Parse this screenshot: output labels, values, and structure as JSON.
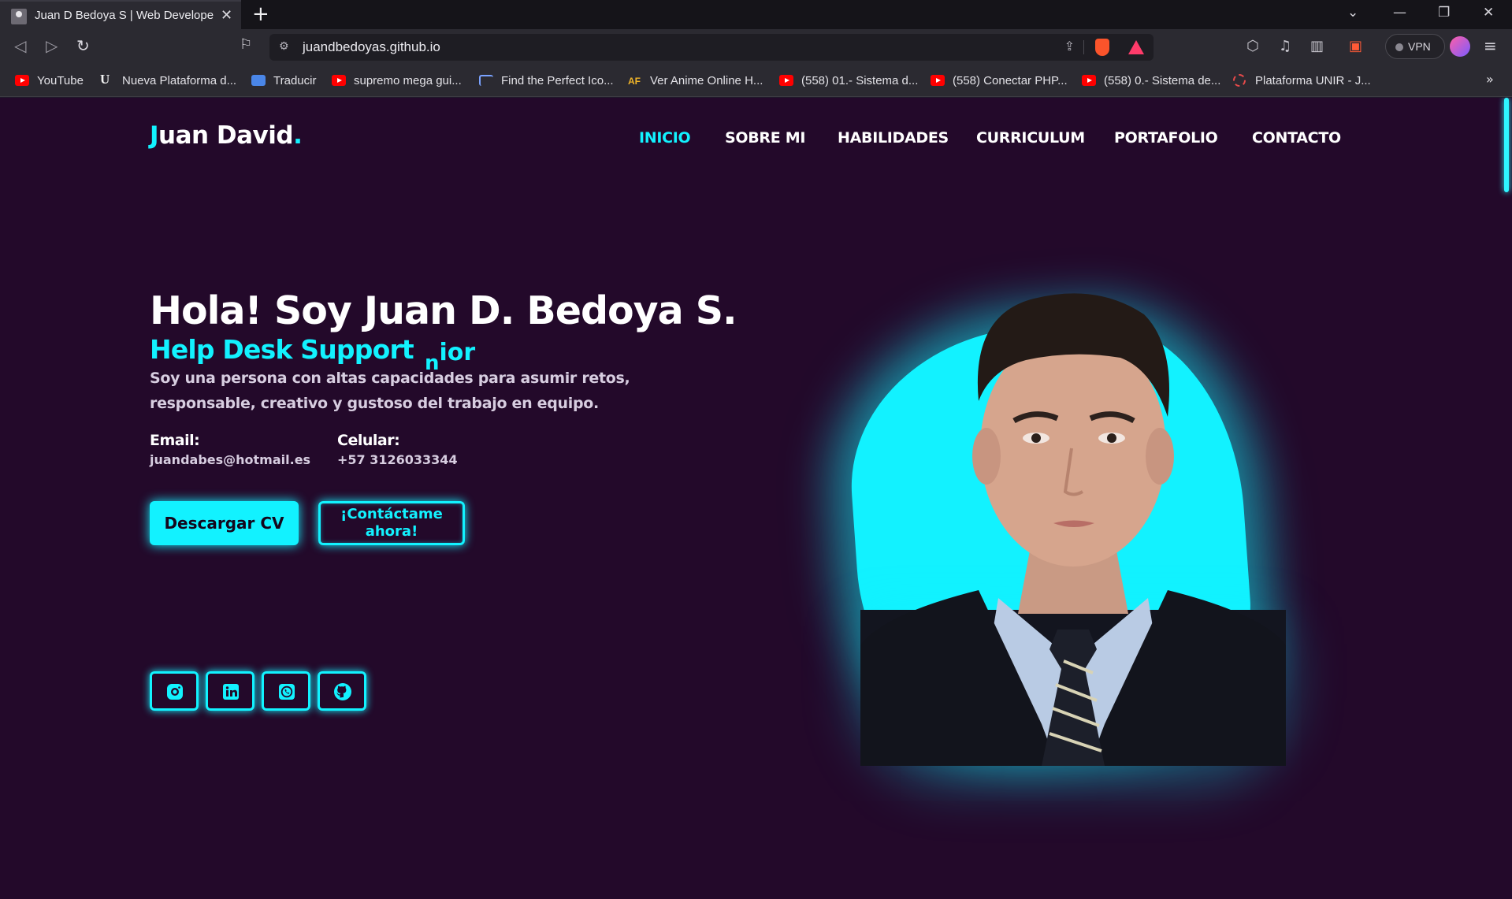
{
  "browser": {
    "tab_title": "Juan D Bedoya S | Web Develope",
    "url": "juandbedoyas.github.io",
    "vpn_label": "VPN",
    "bookmarks": [
      {
        "label": "YouTube",
        "icon": "youtube-icon"
      },
      {
        "label": "Nueva Plataforma d...",
        "icon": "u-logo-icon"
      },
      {
        "label": "Traducir",
        "icon": "google-translate-icon"
      },
      {
        "label": "supremo mega gui...",
        "icon": "youtube-icon"
      },
      {
        "label": "Find the Perfect Ico...",
        "icon": "flag-icon"
      },
      {
        "label": "Ver Anime Online H...",
        "icon": "af-logo-icon"
      },
      {
        "label": "(558) 01.- Sistema d...",
        "icon": "youtube-icon"
      },
      {
        "label": "(558) Conectar PHP...",
        "icon": "youtube-icon"
      },
      {
        "label": "(558) 0.- Sistema de...",
        "icon": "youtube-icon"
      },
      {
        "label": "Plataforma UNIR - J...",
        "icon": "unir-icon"
      }
    ]
  },
  "site": {
    "logo": {
      "first": "J",
      "rest": "uan David",
      "dot": "."
    },
    "nav": [
      {
        "label": "INICIO",
        "active": true
      },
      {
        "label": "SOBRE MI",
        "active": false
      },
      {
        "label": "HABILIDADES",
        "active": false
      },
      {
        "label": "CURRICULUM",
        "active": false
      },
      {
        "label": "PORTAFOLIO",
        "active": false
      },
      {
        "label": "CONTACTO",
        "active": false
      }
    ],
    "hero": {
      "title": "Hola! Soy Juan D. Bedoya S.",
      "role": "Help Desk Support",
      "role_tail_low": "n",
      "role_tail_high": "ior",
      "description": "Soy una persona con altas capacidades para asumir retos, responsable, creativo y gustoso del trabajo en equipo.",
      "email_label": "Email:",
      "email_value": "juandabes@hotmail.es",
      "phone_label": "Celular:",
      "phone_value": "+57 3126033344",
      "download_button": "Descargar CV",
      "contact_button": "¡Contáctame ahora!"
    },
    "social": [
      "instagram-icon",
      "linkedin-icon",
      "whatsapp-icon",
      "github-icon"
    ],
    "accent_color": "#12f2ff",
    "background_color": "#23092a"
  }
}
